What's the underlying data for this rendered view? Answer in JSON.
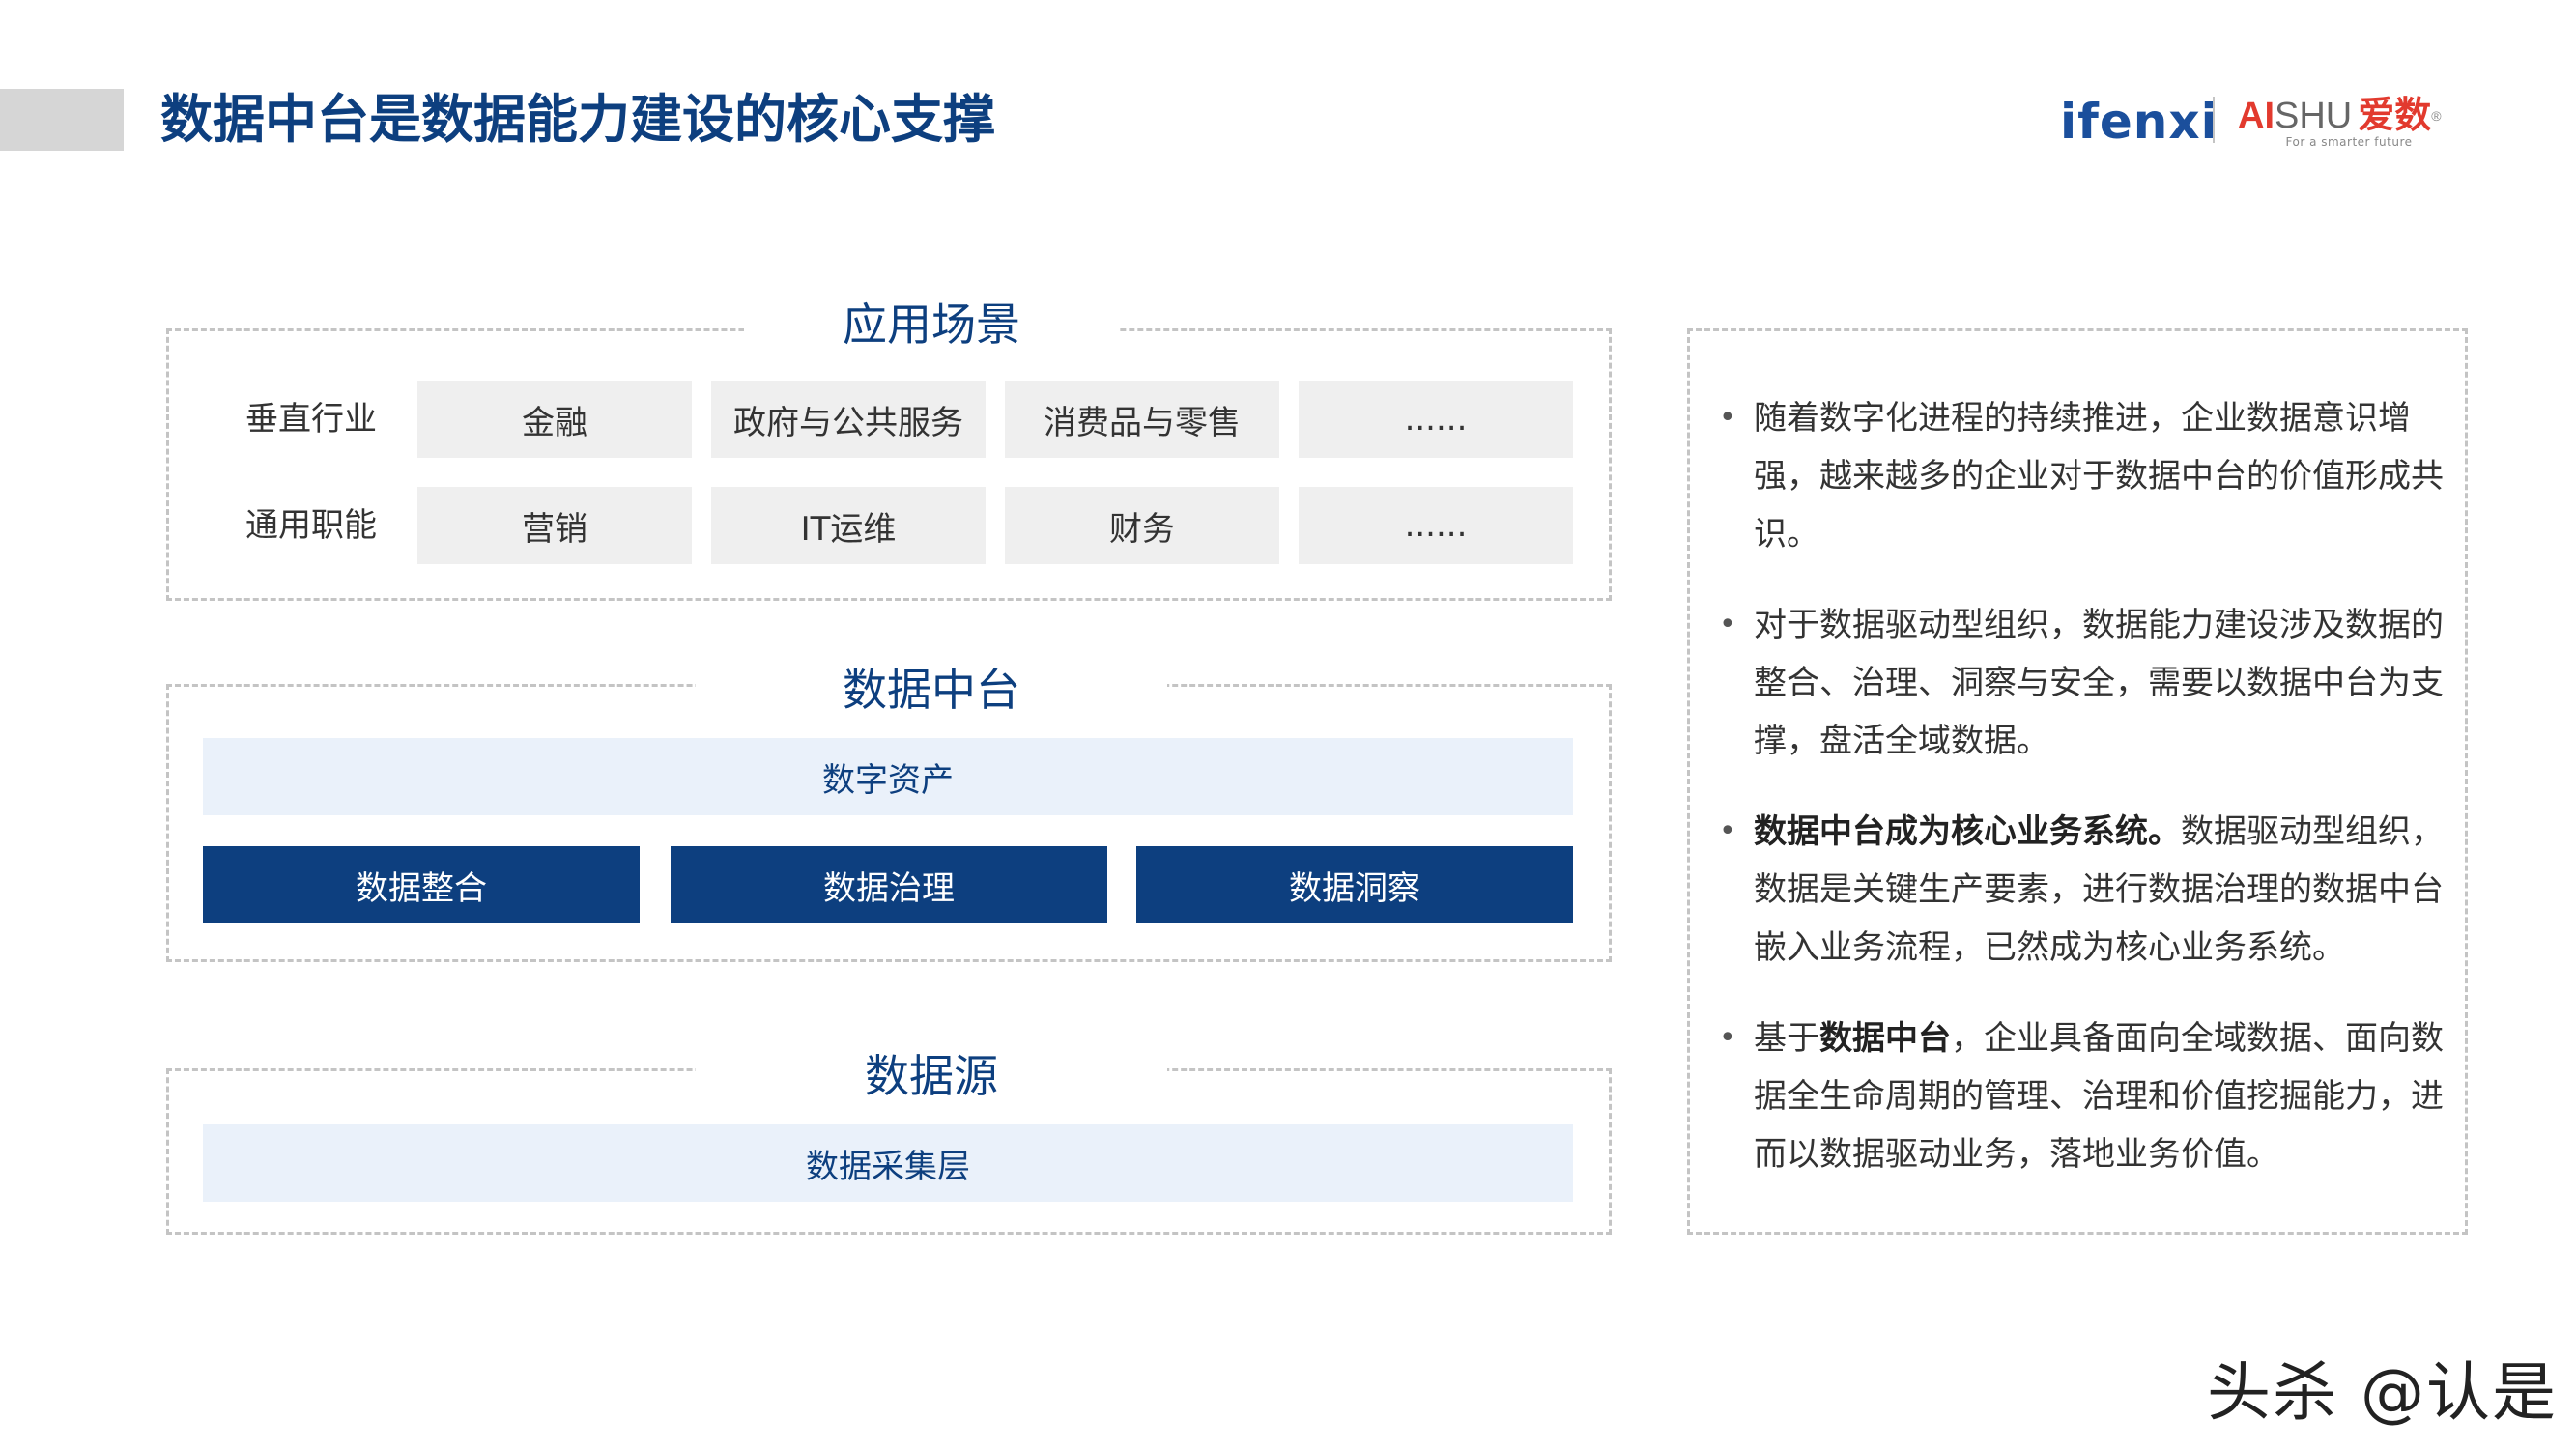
{
  "header": {
    "title": "数据中台是数据能力建设的核心支撑",
    "logo_ifenxi": "ifenxi",
    "logo_aishu_ai": "AI",
    "logo_aishu_shu": "SHU",
    "logo_aishu_cn": "爱数",
    "logo_aishu_tagline": "For a smarter future"
  },
  "diagram": {
    "applications": {
      "title": "应用场景",
      "rows": [
        {
          "label": "垂直行业",
          "cells": [
            "金融",
            "政府与公共服务",
            "消费品与零售",
            "......"
          ]
        },
        {
          "label": "通用职能",
          "cells": [
            "营销",
            "IT运维",
            "财务",
            "......"
          ]
        }
      ]
    },
    "middle_platform": {
      "title": "数据中台",
      "top_bar": "数字资产",
      "boxes": [
        "数据整合",
        "数据治理",
        "数据洞察"
      ]
    },
    "sources": {
      "title": "数据源",
      "bar": "数据采集层"
    }
  },
  "panel": {
    "bullets": [
      {
        "lead": "",
        "text": "随着数字化进程的持续推进，企业数据意识增强，越来越多的企业对于数据中台的价值形成共识。"
      },
      {
        "lead": "",
        "text": "对于数据驱动型组织，数据能力建设涉及数据的整合、治理、洞察与安全，需要以数据中台为支撑，盘活全域数据。"
      },
      {
        "lead": "数据中台成为核心业务系统。",
        "text": "数据驱动型组织，数据是关键生产要素，进行数据治理的数据中台嵌入业务流程，已然成为核心业务系统。"
      },
      {
        "pre": "基于",
        "lead": "数据中台",
        "text": "，企业具备面向全域数据、面向数据全生命周期的管理、治理和价值挖掘能力，进而以数据驱动业务，落地业务价值。"
      }
    ]
  },
  "watermark": "头杀 @认是",
  "colors": {
    "primary": "#0d3f7f",
    "light_fill": "#eaf1fa",
    "cell_fill": "#efefef",
    "dash": "#c4c4c4"
  }
}
